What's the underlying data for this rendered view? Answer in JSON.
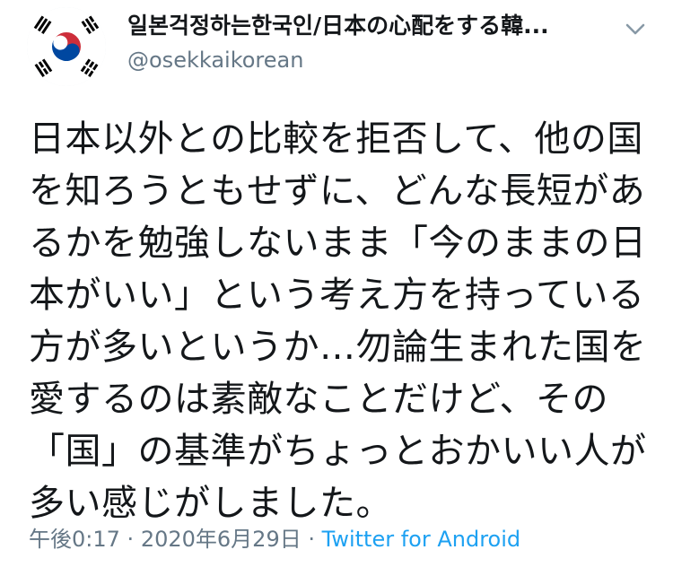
{
  "tweet": {
    "author": {
      "display_name": "일본걱정하는한국인/日本の心配をする韓...",
      "handle": "@osekkaikorean",
      "avatar_icon": "south-korea-flag-icon"
    },
    "menu_icon": "chevron-down-icon",
    "text": "日本以外との比較を拒否して、他の国\nを知ろうともせずに、どんな長短があ\nるかを勉強しないまま「今のままの日\n本がいい」という考え方を持っている\n方が多いというか…勿論生まれた国を\n愛するのは素敵なことだけど、その\n「国」の基準がちょっとおかいい人が\n多い感じがしました。",
    "time": "午後0:17",
    "separator": "·",
    "date": "2020年6月29日",
    "source": "Twitter for Android"
  },
  "colors": {
    "text_primary": "#14171a",
    "text_secondary": "#657786",
    "link": "#1da1f2",
    "flag_red": "#cd2e3a",
    "flag_blue": "#0047a0",
    "flag_black": "#000000"
  }
}
